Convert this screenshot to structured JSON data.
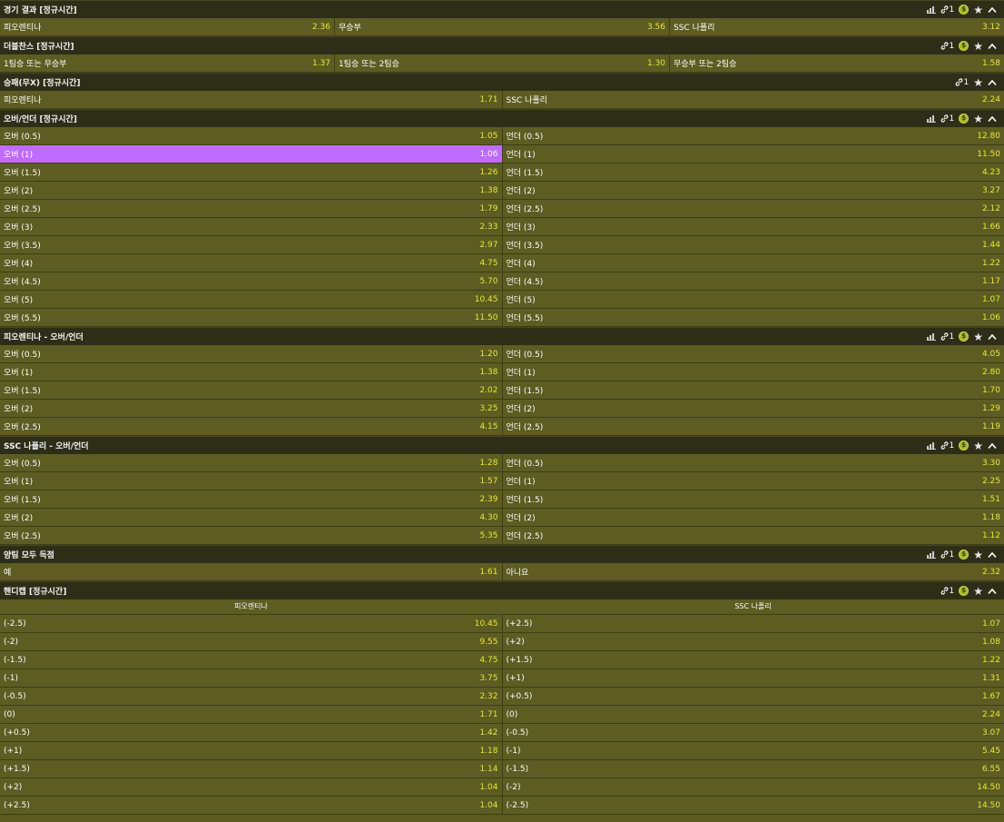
{
  "markets": [
    {
      "title": "경기 결과 [정규시간]",
      "chart": true,
      "link_count": "1",
      "coin": true,
      "rows": [
        [
          [
            "피오렌티나",
            "2.36"
          ],
          [
            "무승부",
            "3.56"
          ],
          [
            "SSC 나폴리",
            "3.12"
          ]
        ]
      ]
    },
    {
      "title": "더블찬스 [정규시간]",
      "chart": false,
      "link_count": "1",
      "coin": true,
      "rows": [
        [
          [
            "1팀승 또는 무승부",
            "1.37"
          ],
          [
            "1팀승 또는 2팀승",
            "1.30"
          ],
          [
            "무승부 또는 2팀승",
            "1.58"
          ]
        ]
      ]
    },
    {
      "title": "승패(무X) [정규시간]",
      "chart": false,
      "link_count": "1",
      "coin": false,
      "rows": [
        [
          [
            "피오렌티나",
            "1.71"
          ],
          [
            "SSC 나폴리",
            "2.24"
          ]
        ]
      ]
    },
    {
      "title": "오버/언더 [정규시간]",
      "chart": true,
      "link_count": "1",
      "coin": true,
      "rows": [
        [
          [
            "오버 (0.5)",
            "1.05"
          ],
          [
            "언더 (0.5)",
            "12.80"
          ]
        ],
        [
          [
            "오버 (1)",
            "1.06"
          ],
          [
            "언더 (1)",
            "11.50"
          ]
        ],
        [
          [
            "오버 (1.5)",
            "1.26"
          ],
          [
            "언더 (1.5)",
            "4.23"
          ]
        ],
        [
          [
            "오버 (2)",
            "1.38"
          ],
          [
            "언더 (2)",
            "3.27"
          ]
        ],
        [
          [
            "오버 (2.5)",
            "1.79"
          ],
          [
            "언더 (2.5)",
            "2.12"
          ]
        ],
        [
          [
            "오버 (3)",
            "2.33"
          ],
          [
            "언더 (3)",
            "1.66"
          ]
        ],
        [
          [
            "오버 (3.5)",
            "2.97"
          ],
          [
            "언더 (3.5)",
            "1.44"
          ]
        ],
        [
          [
            "오버 (4)",
            "4.75"
          ],
          [
            "언더 (4)",
            "1.22"
          ]
        ],
        [
          [
            "오버 (4.5)",
            "5.70"
          ],
          [
            "언더 (4.5)",
            "1.17"
          ]
        ],
        [
          [
            "오버 (5)",
            "10.45"
          ],
          [
            "언더 (5)",
            "1.07"
          ]
        ],
        [
          [
            "오버 (5.5)",
            "11.50"
          ],
          [
            "언더 (5.5)",
            "1.06"
          ]
        ]
      ]
    },
    {
      "title": "피오렌티나 - 오버/언더",
      "chart": true,
      "link_count": "1",
      "coin": true,
      "rows": [
        [
          [
            "오버 (0.5)",
            "1.20"
          ],
          [
            "언더 (0.5)",
            "4.05"
          ]
        ],
        [
          [
            "오버 (1)",
            "1.38"
          ],
          [
            "언더 (1)",
            "2.80"
          ]
        ],
        [
          [
            "오버 (1.5)",
            "2.02"
          ],
          [
            "언더 (1.5)",
            "1.70"
          ]
        ],
        [
          [
            "오버 (2)",
            "3.25"
          ],
          [
            "언더 (2)",
            "1.29"
          ]
        ],
        [
          [
            "오버 (2.5)",
            "4.15"
          ],
          [
            "언더 (2.5)",
            "1.19"
          ]
        ]
      ]
    },
    {
      "title": "SSC 나폴리 - 오버/언더",
      "chart": true,
      "link_count": "1",
      "coin": true,
      "rows": [
        [
          [
            "오버 (0.5)",
            "1.28"
          ],
          [
            "언더 (0.5)",
            "3.30"
          ]
        ],
        [
          [
            "오버 (1)",
            "1.57"
          ],
          [
            "언더 (1)",
            "2.25"
          ]
        ],
        [
          [
            "오버 (1.5)",
            "2.39"
          ],
          [
            "언더 (1.5)",
            "1.51"
          ]
        ],
        [
          [
            "오버 (2)",
            "4.30"
          ],
          [
            "언더 (2)",
            "1.18"
          ]
        ],
        [
          [
            "오버 (2.5)",
            "5.35"
          ],
          [
            "언더 (2.5)",
            "1.12"
          ]
        ]
      ]
    },
    {
      "title": "양팀 모두 득점",
      "chart": true,
      "link_count": "1",
      "coin": true,
      "rows": [
        [
          [
            "예",
            "1.61"
          ],
          [
            "아니요",
            "2.32"
          ]
        ]
      ]
    },
    {
      "title": "핸디캡 [정규시간]",
      "chart": false,
      "link_count": "1",
      "coin": true,
      "teams": [
        "피오렌티나",
        "SSC 나폴리"
      ],
      "rows": [
        [
          [
            "(-2.5)",
            "10.45"
          ],
          [
            "(+2.5)",
            "1.07"
          ]
        ],
        [
          [
            "(-2)",
            "9.55"
          ],
          [
            "(+2)",
            "1.08"
          ]
        ],
        [
          [
            "(-1.5)",
            "4.75"
          ],
          [
            "(+1.5)",
            "1.22"
          ]
        ],
        [
          [
            "(-1)",
            "3.75"
          ],
          [
            "(+1)",
            "1.31"
          ]
        ],
        [
          [
            "(-0.5)",
            "2.32"
          ],
          [
            "(+0.5)",
            "1.67"
          ]
        ],
        [
          [
            "(0)",
            "1.71"
          ],
          [
            "(0)",
            "2.24"
          ]
        ],
        [
          [
            "(+0.5)",
            "1.42"
          ],
          [
            "(-0.5)",
            "3.07"
          ]
        ],
        [
          [
            "(+1)",
            "1.18"
          ],
          [
            "(-1)",
            "5.45"
          ]
        ],
        [
          [
            "(+1.5)",
            "1.14"
          ],
          [
            "(-1.5)",
            "6.55"
          ]
        ],
        [
          [
            "(+2)",
            "1.04"
          ],
          [
            "(-2)",
            "14.50"
          ]
        ],
        [
          [
            "(+2.5)",
            "1.04"
          ],
          [
            "(-2.5)",
            "14.50"
          ]
        ]
      ]
    }
  ],
  "selected": {
    "market": 3,
    "row": 1,
    "col": 0
  },
  "icons": {
    "chart": "bar-chart-icon",
    "link": "link-icon",
    "coin": "coin-icon",
    "star": "star-icon",
    "collapse": "chevron-up-icon"
  },
  "coin_glyph": "$",
  "colors": {
    "header_bg": "#2e2e18",
    "cell_bg": "#5d5c22",
    "odds": "#e8e838",
    "selected": "#bf6bff"
  }
}
